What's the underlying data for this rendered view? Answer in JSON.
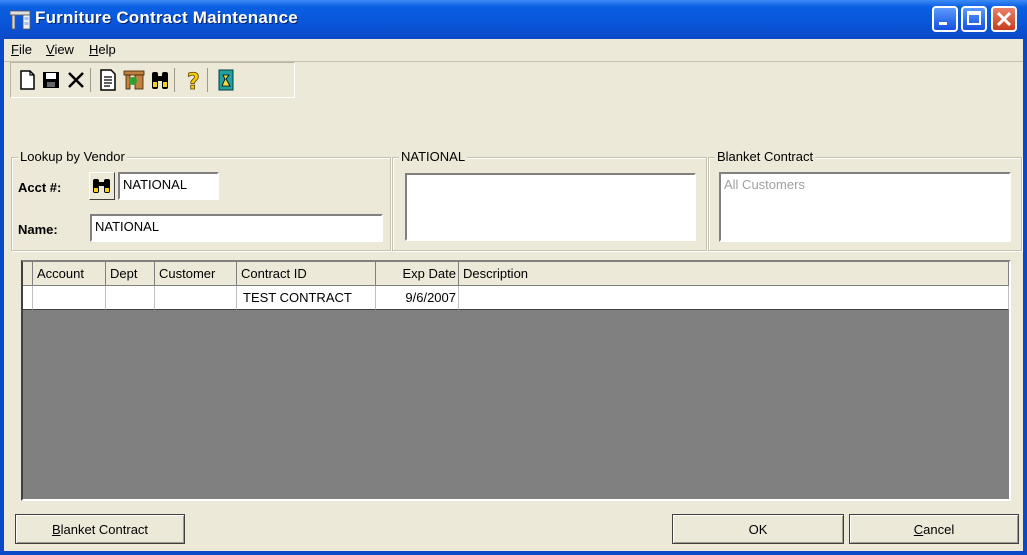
{
  "window": {
    "title": "Furniture Contract Maintenance",
    "title_icon": "furniture-app-icon",
    "controls": [
      "minimize-icon",
      "maximize-icon",
      "close-icon"
    ]
  },
  "menu": {
    "items": [
      {
        "label": "File",
        "hotkey": "F",
        "rest": "ile"
      },
      {
        "label": "View",
        "hotkey": "V",
        "rest": "iew"
      },
      {
        "label": "Help",
        "hotkey": "H",
        "rest": "elp"
      }
    ]
  },
  "toolbar": {
    "icons": [
      "new-document-icon",
      "save-icon",
      "delete-icon",
      "report-icon",
      "contract-icon",
      "binoculars-icon",
      "help-icon",
      "exit-icon"
    ]
  },
  "lookup": {
    "group_label": "Lookup by Vendor",
    "acct_label": "Acct #:",
    "acct_value": "NATIONAL",
    "name_label": "Name:",
    "name_value": "NATIONAL"
  },
  "vendor_panel": {
    "group_label": "NATIONAL",
    "text": ""
  },
  "blanket": {
    "group_label": "Blanket Contract",
    "text": "All Customers"
  },
  "grid": {
    "columns": [
      "Account",
      "Dept",
      "Customer",
      "Contract ID",
      "Exp Date",
      "Description"
    ],
    "rows": [
      {
        "account": "",
        "dept": "",
        "customer": "",
        "contract_id": "TEST CONTRACT",
        "exp_date": "9/6/2007",
        "description": ""
      }
    ]
  },
  "buttons": {
    "blanket": {
      "hotkey": "B",
      "rest": "lanket Contract"
    },
    "ok": "OK",
    "cancel": {
      "hotkey": "C",
      "rest": "ancel"
    }
  },
  "colors": {
    "titlebar": "#0a55d8",
    "window_bg": "#ece9d8",
    "grid_bg": "#808080"
  }
}
